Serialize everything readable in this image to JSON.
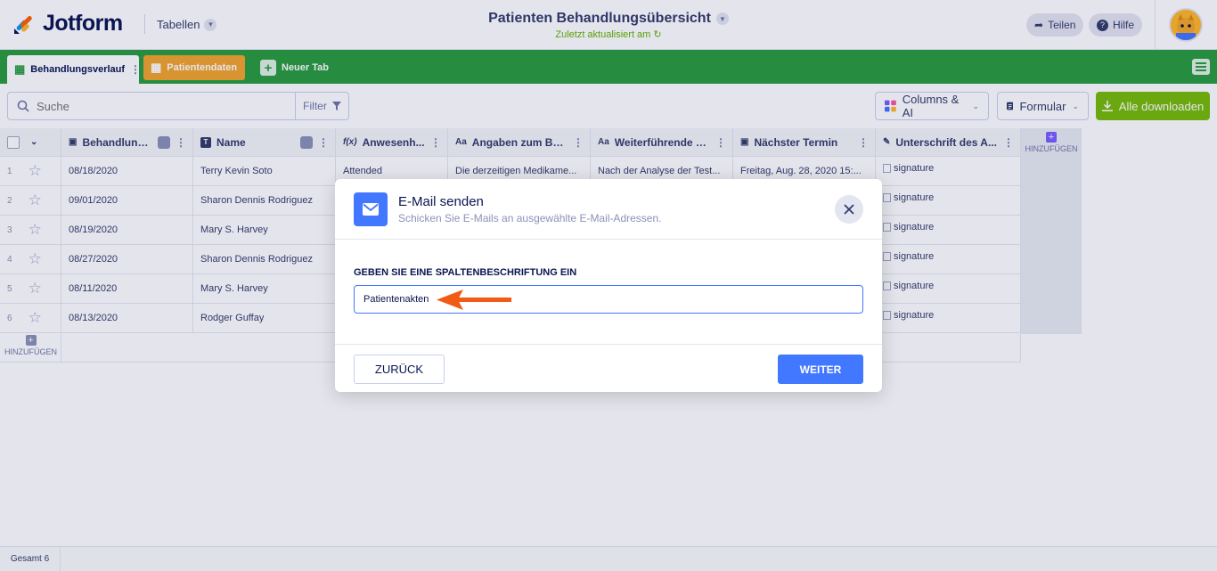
{
  "header": {
    "logo_text": "Jotform",
    "app_switch_label": "Tabellen",
    "doc_title": "Patienten Behandlungsübersicht",
    "doc_subtitle": "Zuletzt aktualisiert am",
    "share_label": "Teilen",
    "help_label": "Hilfe"
  },
  "tabs": [
    {
      "label": "Behandlungsverlauf"
    },
    {
      "label": "Patientendaten"
    },
    {
      "label": "Neuer Tab"
    }
  ],
  "toolbar": {
    "search_placeholder": "Suche",
    "filter_label": "Filter",
    "columns_label": "Columns & AI",
    "form_label": "Formular",
    "download_label": "Alle downloaden"
  },
  "table": {
    "columns": [
      {
        "label": "Behandlung..."
      },
      {
        "label": "Name"
      },
      {
        "label": "Anwesenh..."
      },
      {
        "label": "Angaben zum Be..."
      },
      {
        "label": "Weiterführende B..."
      },
      {
        "label": "Nächster Termin"
      },
      {
        "label": "Unterschrift des A..."
      }
    ],
    "add_column_label": "HINZUFÜGEN",
    "add_row_label": "HINZUFÜGEN",
    "rows": [
      {
        "num": "1",
        "date": "08/18/2020",
        "name": "Terry Kevin Soto",
        "attendance": "Attended",
        "info": "Die derzeitigen Medikame...",
        "further": "Nach der Analyse der Test...",
        "next": "Freitag, Aug. 28, 2020 15:...",
        "sig": "signature"
      },
      {
        "num": "2",
        "date": "09/01/2020",
        "name": "Sharon Dennis Rodriguez",
        "attendance": "",
        "info": "",
        "further": "",
        "next": "",
        "sig": "signature"
      },
      {
        "num": "3",
        "date": "08/19/2020",
        "name": "Mary S. Harvey",
        "attendance": "",
        "info": "",
        "further": "",
        "next": "",
        "sig": "signature"
      },
      {
        "num": "4",
        "date": "08/27/2020",
        "name": "Sharon Dennis Rodriguez",
        "attendance": "",
        "info": "",
        "further": "",
        "next": "",
        "sig": "signature"
      },
      {
        "num": "5",
        "date": "08/11/2020",
        "name": "Mary S. Harvey",
        "attendance": "",
        "info": "",
        "further": "",
        "next": "",
        "sig": "signature"
      },
      {
        "num": "6",
        "date": "08/13/2020",
        "name": "Rodger Guffay",
        "attendance": "",
        "info": "",
        "further": "",
        "next": "",
        "sig": "signature"
      }
    ]
  },
  "footer": {
    "total_label": "Gesamt 6"
  },
  "modal": {
    "title": "E-Mail senden",
    "subtitle": "Schicken Sie E-Mails an ausgewählte E-Mail-Adressen.",
    "field_label": "GEBEN SIE EINE SPALTENBESCHRIFTUNG EIN",
    "field_value": "Patientenakten",
    "back_label": "ZURÜCK",
    "next_label": "WEITER"
  },
  "colors": {
    "tab_bar": "#2a9d3e",
    "tab_second": "#f2a42c",
    "primary_blue": "#4277ff",
    "download_green": "#78bb07",
    "annotation_arrow": "#f25b16"
  }
}
